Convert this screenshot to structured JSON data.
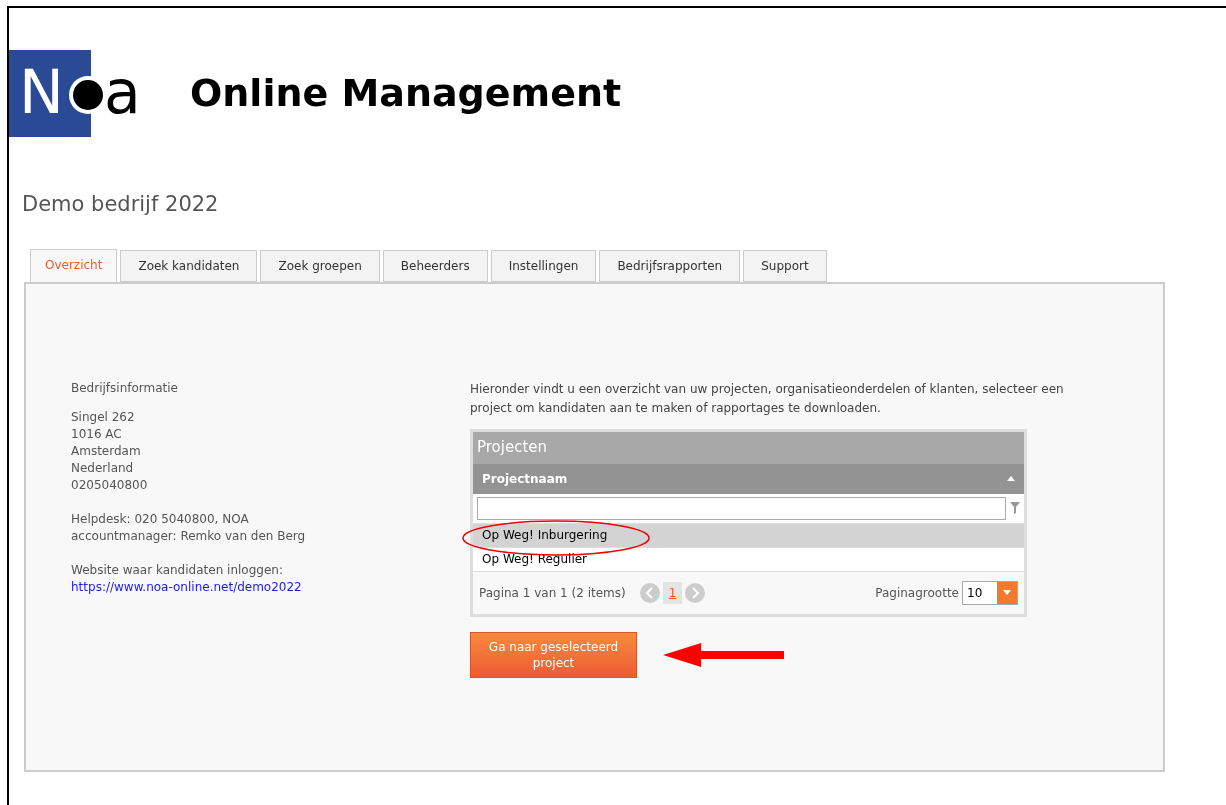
{
  "header": {
    "logo_initial": "N",
    "logo_final": "a",
    "title": "Online Management"
  },
  "company": "Demo bedrijf 2022",
  "tabs": [
    {
      "label": "Overzicht",
      "selected": true
    },
    {
      "label": "Zoek kandidaten",
      "selected": false
    },
    {
      "label": "Zoek groepen",
      "selected": false
    },
    {
      "label": "Beheerders",
      "selected": false
    },
    {
      "label": "Instellingen",
      "selected": false
    },
    {
      "label": "Bedrijfsrapporten",
      "selected": false
    },
    {
      "label": "Support",
      "selected": false
    }
  ],
  "info": {
    "heading": "Bedrijfsinformatie",
    "address": [
      "Singel 262",
      "1016 AC",
      "Amsterdam",
      "Nederland",
      "0205040800"
    ],
    "contact": [
      "Helpdesk: 020 5040800, NOA",
      "accountmanager: Remko van den Berg"
    ],
    "website_label": "Website waar kandidaten inloggen:",
    "website_link": "https://www.noa-online.net/demo2022"
  },
  "intro": "Hieronder vindt u een overzicht van uw projecten, organisatieonderdelen of klanten, selecteer een project om kandidaten aan te maken of rapportages te downloaden.",
  "grid": {
    "title": "Projecten",
    "column": "Projectnaam",
    "rows": [
      {
        "name": "Op Weg! Inburgering",
        "selected": true
      },
      {
        "name": "Op Weg! Regulier",
        "selected": false
      }
    ],
    "pager_info": "Pagina 1 van 1 (2 items)",
    "pages": [
      {
        "label": "1",
        "selected": true
      }
    ],
    "page_size_label": "Paginagrootte",
    "page_size": "10"
  },
  "button": "Ga naar geselecteerd project"
}
